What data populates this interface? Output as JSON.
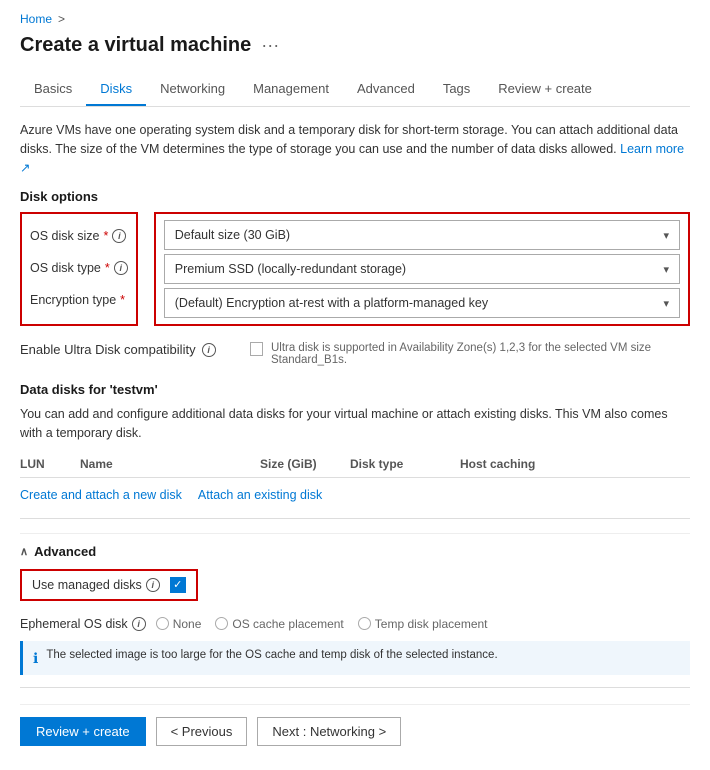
{
  "breadcrumb": {
    "home": "Home",
    "separator": ">"
  },
  "page": {
    "title": "Create a virtual machine",
    "dots": "···"
  },
  "tabs": [
    {
      "label": "Basics",
      "active": false
    },
    {
      "label": "Disks",
      "active": true
    },
    {
      "label": "Networking",
      "active": false
    },
    {
      "label": "Management",
      "active": false
    },
    {
      "label": "Advanced",
      "active": false
    },
    {
      "label": "Tags",
      "active": false
    },
    {
      "label": "Review + create",
      "active": false
    }
  ],
  "description": {
    "main": "Azure VMs have one operating system disk and a temporary disk for short-term storage. You can attach additional data disks. The size of the VM determines the type of storage you can use and the number of data disks allowed.",
    "learn_more": "Learn more",
    "learn_more_icon": "↗"
  },
  "disk_options": {
    "title": "Disk options",
    "labels": [
      {
        "text": "OS disk size",
        "required": true
      },
      {
        "text": "OS disk type",
        "required": true
      },
      {
        "text": "Encryption type",
        "required": true
      }
    ],
    "dropdowns": [
      {
        "value": "Default size (30 GiB)"
      },
      {
        "value": "Premium SSD (locally-redundant storage)"
      },
      {
        "value": "(Default) Encryption at-rest with a platform-managed key"
      }
    ]
  },
  "ultra_disk": {
    "label": "Enable Ultra Disk compatibility",
    "desc": "Ultra disk is supported in Availability Zone(s) 1,2,3 for the selected VM size Standard_B1s."
  },
  "data_disks": {
    "title": "Data disks for 'testvm'",
    "desc": "You can add and configure additional data disks for your virtual machine or attach existing disks. This VM also comes with a temporary disk.",
    "columns": [
      "LUN",
      "Name",
      "Size (GiB)",
      "Disk type",
      "Host caching"
    ],
    "create_link": "Create and attach a new disk",
    "attach_link": "Attach an existing disk"
  },
  "advanced": {
    "title": "Advanced",
    "managed_disks_label": "Use managed disks",
    "ephemeral_label": "Ephemeral OS disk",
    "radio_options": [
      "None",
      "OS cache placement",
      "Temp disk placement"
    ],
    "info_text": "The selected image is too large for the OS cache and temp disk of the selected instance."
  },
  "footer": {
    "review_btn": "Review + create",
    "prev_btn": "< Previous",
    "next_btn": "Next : Networking >"
  }
}
